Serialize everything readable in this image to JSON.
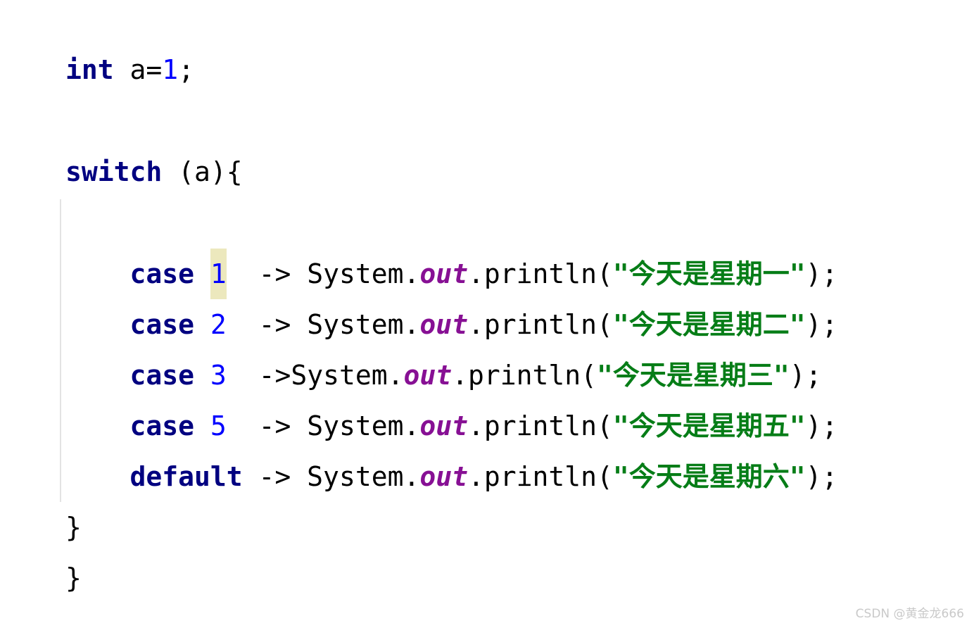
{
  "document": {
    "kind": "java-source-snippet",
    "background_color": "#ffffff",
    "font_size_px": 38
  },
  "theme": {
    "keyword_color": "#000080",
    "number_color": "#0000ff",
    "string_color": "#067d17",
    "static_field_color": "#871094",
    "plain_color": "#000000",
    "highlight_background": "#ece8bd",
    "indent_guide_color": "#e3e3e3",
    "watermark_color": "#c9c9c9"
  },
  "code": {
    "lines": [
      {
        "id": "line-declaration",
        "tokens": [
          {
            "kind": "keyword",
            "text": "int"
          },
          {
            "kind": "plain",
            "text": " a="
          },
          {
            "kind": "number",
            "text": "1"
          },
          {
            "kind": "plain",
            "text": ";"
          }
        ]
      },
      {
        "id": "line-switch-open",
        "tokens": [
          {
            "kind": "keyword",
            "text": "switch"
          },
          {
            "kind": "plain",
            "text": " (a){"
          }
        ]
      },
      {
        "id": "line-case-1",
        "tokens": [
          {
            "kind": "plain",
            "text": "    "
          },
          {
            "kind": "keyword",
            "text": "case"
          },
          {
            "kind": "plain",
            "text": " "
          },
          {
            "kind": "number-highlighted",
            "text": "1"
          },
          {
            "kind": "plain",
            "text": "  -> System."
          },
          {
            "kind": "static",
            "text": "out"
          },
          {
            "kind": "plain",
            "text": ".println("
          },
          {
            "kind": "string",
            "text": "\"今天是星期一\""
          },
          {
            "kind": "plain",
            "text": ");"
          }
        ]
      },
      {
        "id": "line-case-2",
        "tokens": [
          {
            "kind": "plain",
            "text": "    "
          },
          {
            "kind": "keyword",
            "text": "case"
          },
          {
            "kind": "plain",
            "text": " "
          },
          {
            "kind": "number",
            "text": "2"
          },
          {
            "kind": "plain",
            "text": "  -> System."
          },
          {
            "kind": "static",
            "text": "out"
          },
          {
            "kind": "plain",
            "text": ".println("
          },
          {
            "kind": "string",
            "text": "\"今天是星期二\""
          },
          {
            "kind": "plain",
            "text": ");"
          }
        ]
      },
      {
        "id": "line-case-3",
        "tokens": [
          {
            "kind": "plain",
            "text": "    "
          },
          {
            "kind": "keyword",
            "text": "case"
          },
          {
            "kind": "plain",
            "text": " "
          },
          {
            "kind": "number",
            "text": "3"
          },
          {
            "kind": "plain",
            "text": "  ->System."
          },
          {
            "kind": "static",
            "text": "out"
          },
          {
            "kind": "plain",
            "text": ".println("
          },
          {
            "kind": "string",
            "text": "\"今天是星期三\""
          },
          {
            "kind": "plain",
            "text": ");"
          }
        ]
      },
      {
        "id": "line-case-5",
        "tokens": [
          {
            "kind": "plain",
            "text": "    "
          },
          {
            "kind": "keyword",
            "text": "case"
          },
          {
            "kind": "plain",
            "text": " "
          },
          {
            "kind": "number",
            "text": "5"
          },
          {
            "kind": "plain",
            "text": "  -> System."
          },
          {
            "kind": "static",
            "text": "out"
          },
          {
            "kind": "plain",
            "text": ".println("
          },
          {
            "kind": "string",
            "text": "\"今天是星期五\""
          },
          {
            "kind": "plain",
            "text": ");"
          }
        ]
      },
      {
        "id": "line-default",
        "tokens": [
          {
            "kind": "plain",
            "text": "    "
          },
          {
            "kind": "keyword",
            "text": "default"
          },
          {
            "kind": "plain",
            "text": " -> System."
          },
          {
            "kind": "static",
            "text": "out"
          },
          {
            "kind": "plain",
            "text": ".println("
          },
          {
            "kind": "string",
            "text": "\"今天是星期六\""
          },
          {
            "kind": "plain",
            "text": ");"
          }
        ]
      },
      {
        "id": "line-switch-close",
        "tokens": [
          {
            "kind": "plain",
            "text": "}"
          }
        ]
      },
      {
        "id": "line-block-close",
        "tokens": [
          {
            "kind": "plain",
            "text": "}"
          }
        ]
      }
    ]
  },
  "watermark": {
    "text": "CSDN @黄金龙666"
  }
}
